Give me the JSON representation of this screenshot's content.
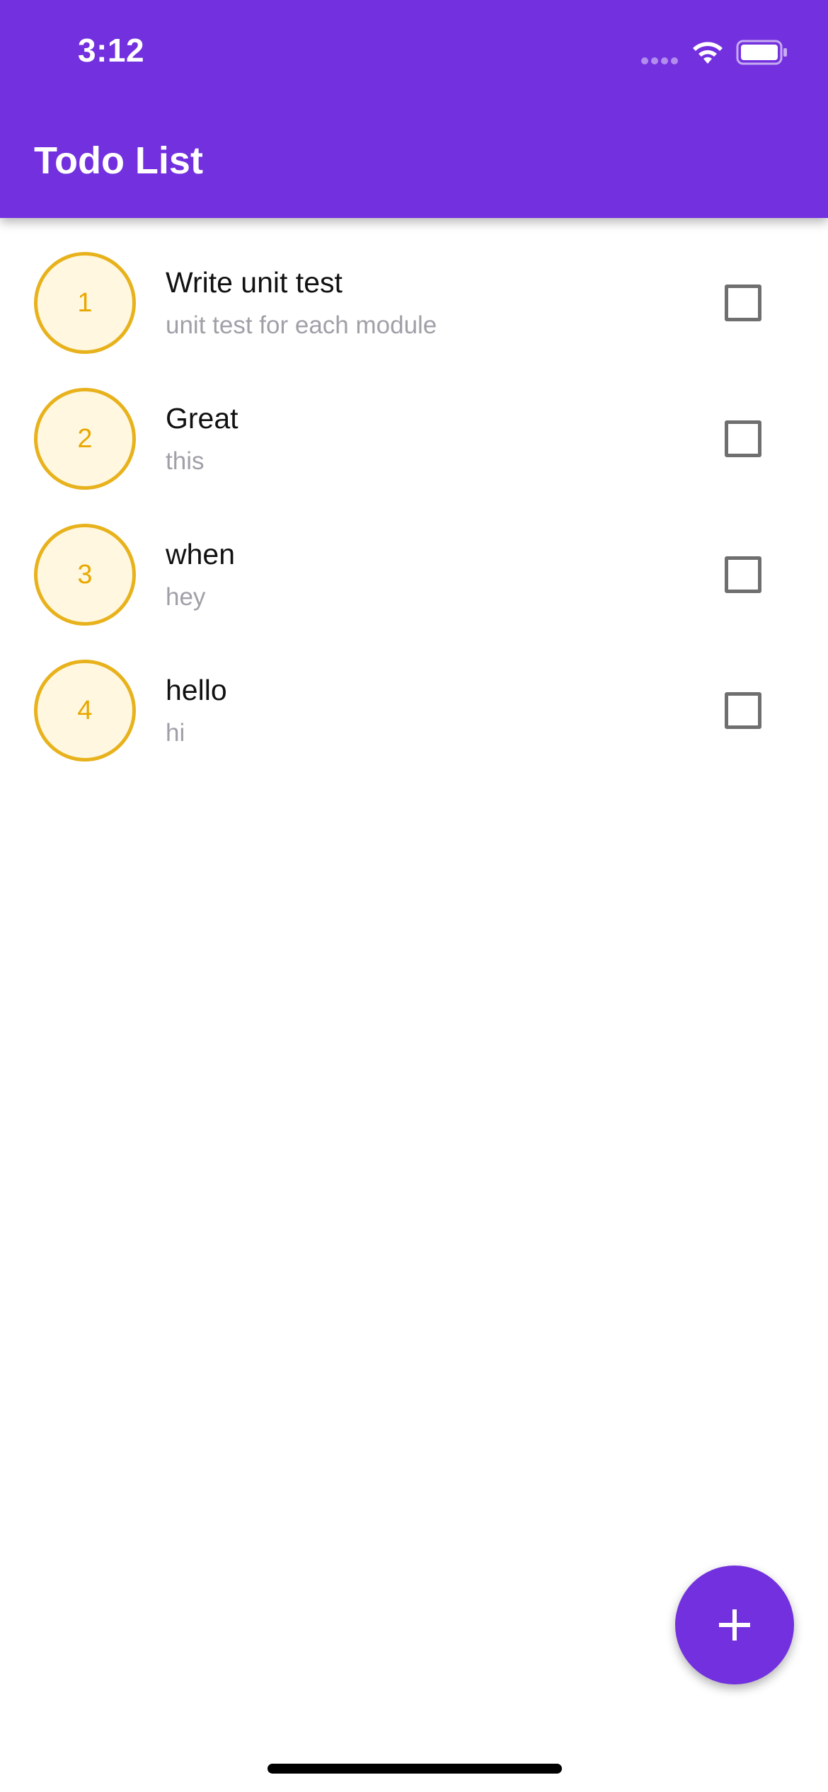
{
  "status_bar": {
    "time": "3:12",
    "icons": [
      "signal-dots-icon",
      "wifi-icon",
      "battery-icon"
    ]
  },
  "header": {
    "title": "Todo List",
    "background_color": "#7330de"
  },
  "todos": [
    {
      "number": "1",
      "title": "Write unit test",
      "subtitle": "unit test for each module",
      "checked": false
    },
    {
      "number": "2",
      "title": "Great",
      "subtitle": "this",
      "checked": false
    },
    {
      "number": "3",
      "title": "when",
      "subtitle": "hey",
      "checked": false
    },
    {
      "number": "4",
      "title": "hello",
      "subtitle": "hi",
      "checked": false
    }
  ],
  "fab": {
    "icon": "plus-icon",
    "color": "#7330de"
  },
  "colors": {
    "accent": "#7330de",
    "circle_border": "#e8b21c",
    "circle_fill": "#fff7e0",
    "circle_text": "#e8a800",
    "subtitle_text": "#a0a0a8"
  }
}
